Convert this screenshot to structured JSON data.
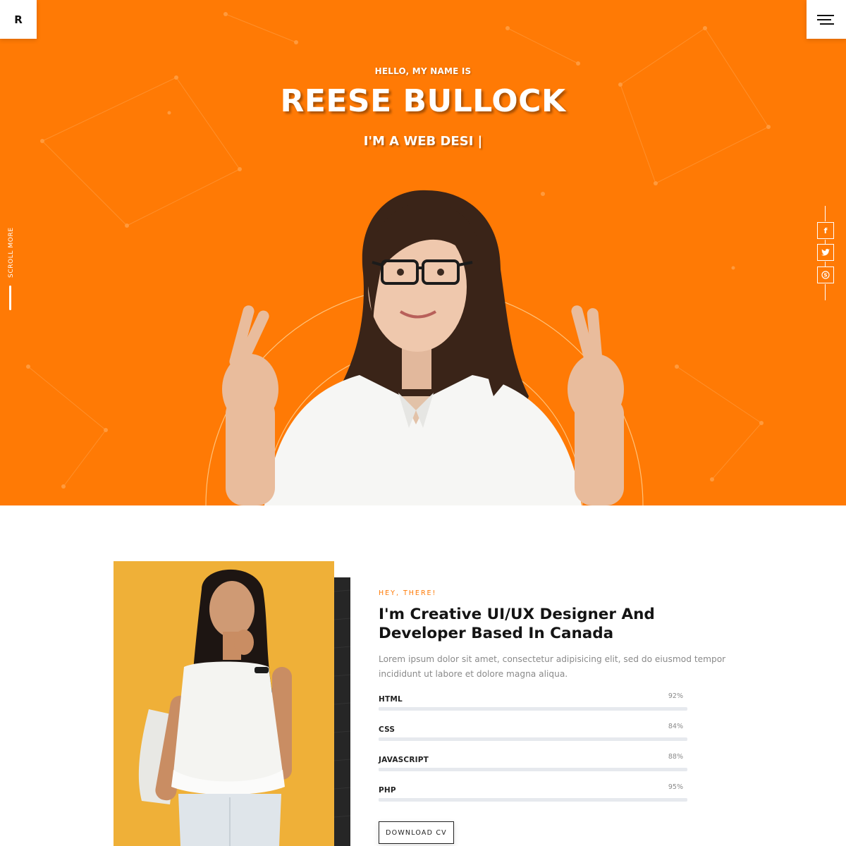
{
  "brand": {
    "logo_letter": "R"
  },
  "hero": {
    "greeting": "HELLO, MY NAME IS",
    "name": "REESE BULLOCK",
    "role_typed": "I'M A WEB DESI |",
    "accent_color": "#ff7a05",
    "scroll_label": "SCROLL MORE"
  },
  "social": [
    {
      "icon": "facebook-icon",
      "glyph": "f"
    },
    {
      "icon": "twitter-icon",
      "glyph": "t"
    },
    {
      "icon": "skype-icon",
      "glyph": "S"
    }
  ],
  "about": {
    "eyebrow": "HEY, THERE!",
    "title": "I'm Creative UI/UX Designer And Developer Based In Canada",
    "description": "Lorem ipsum dolor sit amet, consectetur adipisicing elit, sed do eiusmod tempor incididunt ut labore et dolore magna aliqua.",
    "skills": [
      {
        "name": "HTML",
        "percent_label": "92%",
        "value": 92
      },
      {
        "name": "CSS",
        "percent_label": "84%",
        "value": 84
      },
      {
        "name": "JAVASCRIPT",
        "percent_label": "88%",
        "value": 88
      },
      {
        "name": "PHP",
        "percent_label": "95%",
        "value": 95
      }
    ],
    "cv_button": "DOWNLOAD CV"
  }
}
